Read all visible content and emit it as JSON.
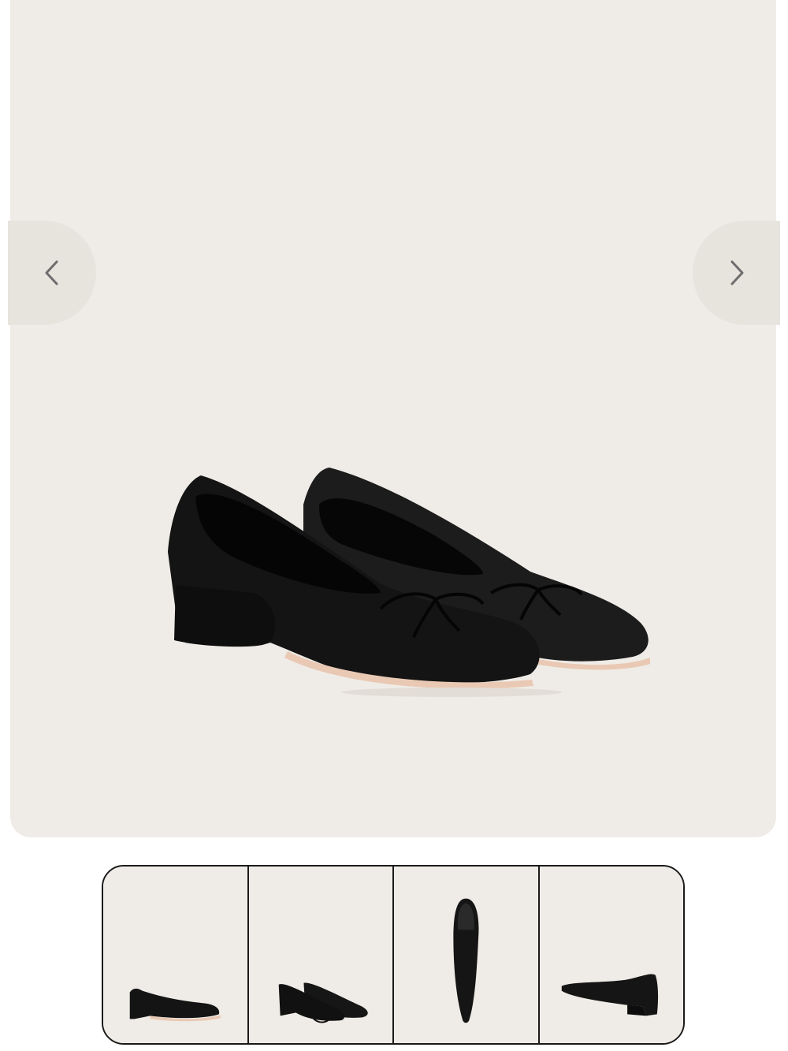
{
  "gallery": {
    "main_image": {
      "icon": "ballet-flat-pair-front-angle",
      "selected_thumbnail": 0
    },
    "prev_button": {
      "icon": "chevron-left-icon"
    },
    "next_button": {
      "icon": "chevron-right-icon"
    },
    "thumbnails": [
      {
        "icon": "ballet-flat-side-view"
      },
      {
        "icon": "ballet-flat-pair-view"
      },
      {
        "icon": "ballet-flat-top-view"
      },
      {
        "icon": "ballet-flat-back-angle-view"
      }
    ]
  },
  "colors": {
    "image_background": "#efece7",
    "nav_button_background": "#e7e3dd",
    "leather": "#141414",
    "sole": "#e9c9b4",
    "thumb_border": "#1a1a1a"
  }
}
